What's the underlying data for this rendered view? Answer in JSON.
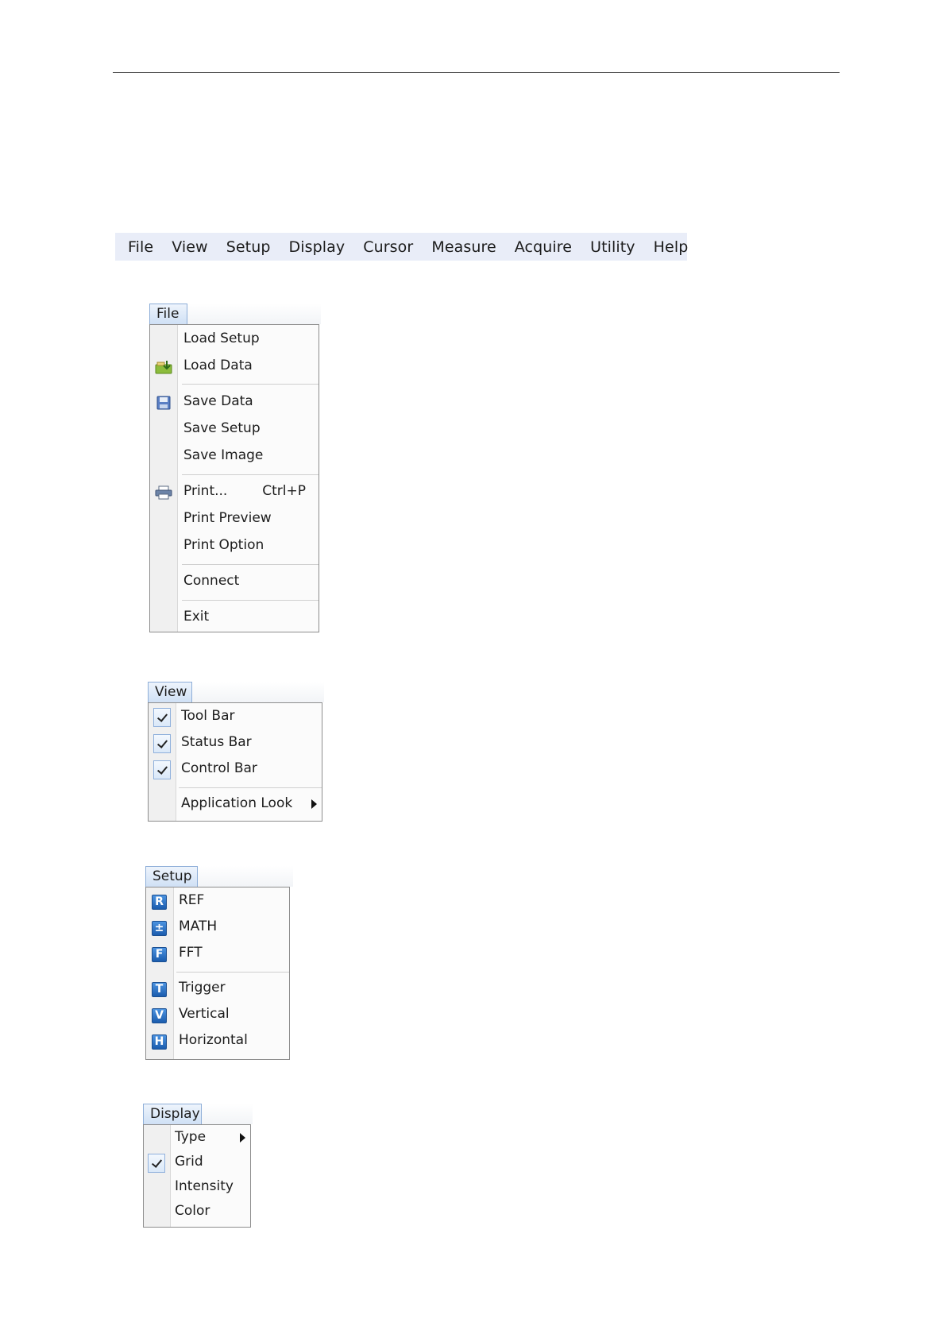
{
  "menubar": {
    "items": [
      "File",
      "View",
      "Setup",
      "Display",
      "Cursor",
      "Measure",
      "Acquire",
      "Utility",
      "Help"
    ]
  },
  "file_menu": {
    "tab": "File",
    "items": [
      {
        "label": "Load Setup",
        "icon": null
      },
      {
        "label": "Load Data",
        "icon": "load-data-icon"
      },
      {
        "label": "Save Data",
        "icon": "save-disk-icon"
      },
      {
        "label": "Save Setup",
        "icon": null
      },
      {
        "label": "Save Image",
        "icon": null
      },
      {
        "label": "Print...",
        "icon": "printer-icon",
        "shortcut": "Ctrl+P"
      },
      {
        "label": "Print Preview",
        "icon": null
      },
      {
        "label": "Print Option",
        "icon": null
      },
      {
        "label": "Connect",
        "icon": null
      },
      {
        "label": "Exit",
        "icon": null
      }
    ]
  },
  "view_menu": {
    "tab": "View",
    "items": [
      {
        "label": "Tool Bar",
        "checked": true
      },
      {
        "label": "Status Bar",
        "checked": true
      },
      {
        "label": "Control Bar",
        "checked": true
      },
      {
        "label": "Application Look",
        "checked": false,
        "submenu": true
      }
    ]
  },
  "setup_menu": {
    "tab": "Setup",
    "items": [
      {
        "label": "REF",
        "icon_letter": "R"
      },
      {
        "label": "MATH",
        "icon_letter": "±"
      },
      {
        "label": "FFT",
        "icon_letter": "F"
      },
      {
        "label": "Trigger",
        "icon_letter": "T"
      },
      {
        "label": "Vertical",
        "icon_letter": "V"
      },
      {
        "label": "Horizontal",
        "icon_letter": "H"
      }
    ]
  },
  "display_menu": {
    "tab": "Display",
    "items": [
      {
        "label": "Type",
        "checked": false,
        "submenu": true
      },
      {
        "label": "Grid",
        "checked": true
      },
      {
        "label": "Intensity",
        "checked": false
      },
      {
        "label": "Color",
        "checked": false
      }
    ]
  }
}
